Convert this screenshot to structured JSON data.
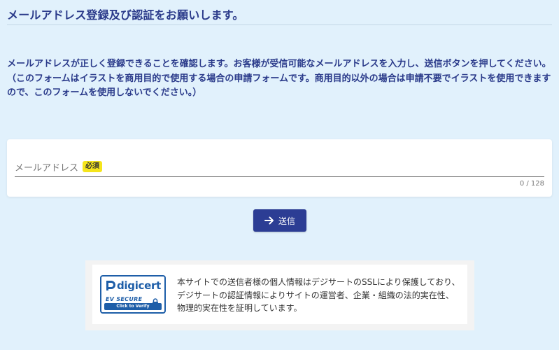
{
  "header": {
    "title": "メールアドレス登録及び認証をお願いします。"
  },
  "intro": {
    "main": "メールアドレスが正しく登録できることを確認します。お客様が受信可能なメールアドレスを入力し、送信ボタンを押してください。",
    "note": "（このフォームはイラストを商用目的で使用する場合の申請フォームです。商用目的以外の場合は申請不要でイラストを使用できますので、このフォームを使用しないでください。）"
  },
  "form": {
    "email_label": "メールアドレス",
    "required_badge": "必須",
    "email_value": "",
    "char_counter": "0 / 128",
    "submit_label": "送信"
  },
  "ssl": {
    "seal": {
      "brand": "digicert",
      "ev_label": "EV SECURE",
      "verify_label": "Click to Verify"
    },
    "lines": [
      "本サイトでの送信者様の個人情報はデジサートのSSLにより保護しており、",
      "デジサートの認証情報によりサイトの運営者、企業・組織の法的実在性、",
      "物理的実在性を証明しています。"
    ]
  },
  "colors": {
    "background": "#e1f1fc",
    "primary_text": "#2a3a8a",
    "button": "#2c3d94",
    "badge": "#f5e51c",
    "seal_blue": "#1e5ea8"
  }
}
